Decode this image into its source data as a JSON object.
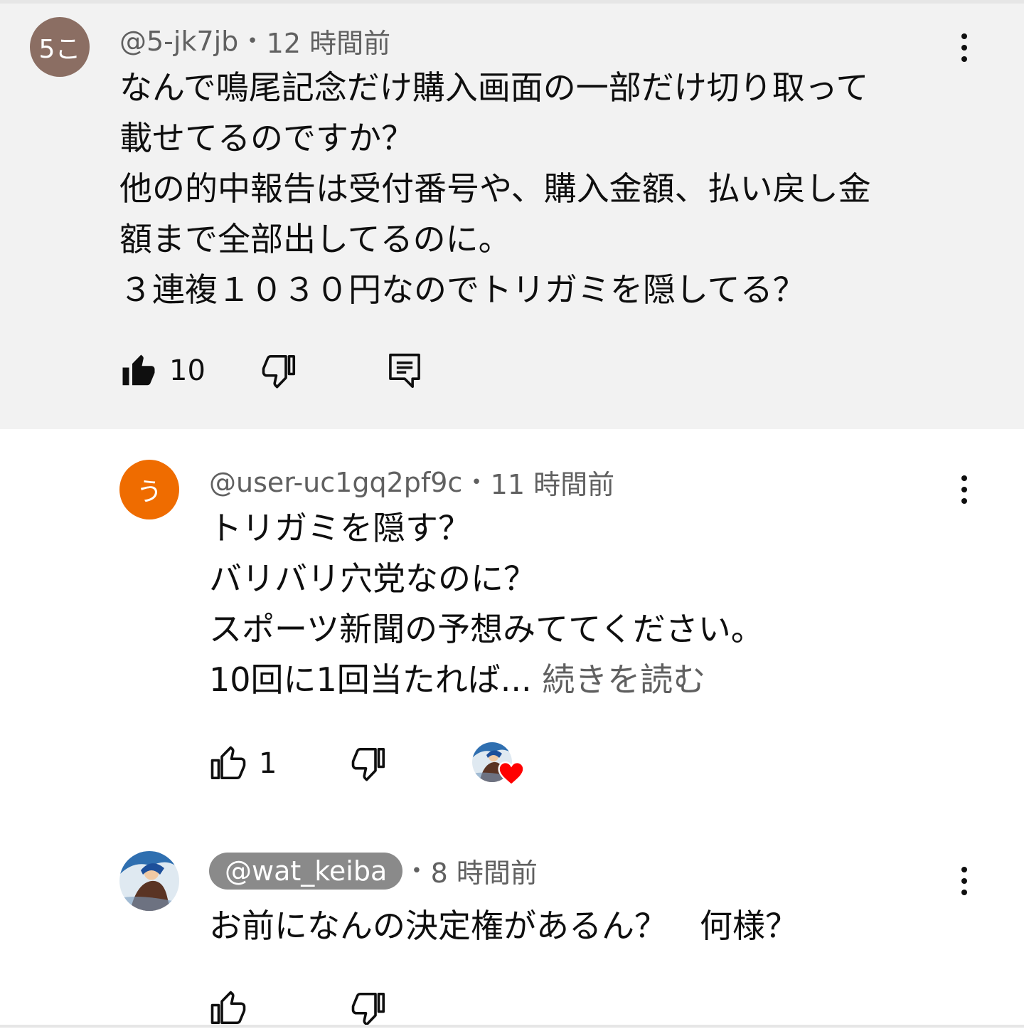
{
  "comments": [
    {
      "avatar_text": "5こ",
      "avatar_color": "#8b6e63",
      "handle": "@5-jk7jb",
      "separator": "•",
      "time": "12 時間前",
      "lines": [
        "なんで鳴尾記念だけ購入画面の一部だけ切り取って",
        "載せてるのですか？",
        "他の的中報告は受付番号や、購入金額、払い戻し金",
        "額まで全部出してるのに。",
        "３連複１０３０円なのでトリガミを隠してる？"
      ],
      "like_count": "10",
      "liked": true,
      "highlighted": true
    },
    {
      "avatar_text": "う",
      "avatar_color": "#ef6c00",
      "handle": "@user-uc1gq2pf9c",
      "separator": "•",
      "time": "11 時間前",
      "lines": [
        "トリガミを隠す？",
        "バリバリ穴党なのに？",
        "スポーツ新聞の予想みててください。",
        "10回に1回当たれば..."
      ],
      "read_more": "続きを読む",
      "like_count": "1",
      "liked": false,
      "creator_heart": true
    },
    {
      "handle": "@wat_keiba",
      "is_owner": true,
      "separator": "•",
      "time": "8 時間前",
      "lines": [
        "お前になんの決定権があるん？　何様？"
      ],
      "like_count": "",
      "liked": false
    }
  ],
  "colors": {
    "highlight_background": "#f2f2f2",
    "meta_text": "#606060",
    "owner_chip": "#8a8a8a",
    "heart": "#ff0000"
  },
  "icons": [
    "like-icon",
    "dislike-icon",
    "reply-icon",
    "more-options-icon",
    "creator-heart-icon"
  ]
}
